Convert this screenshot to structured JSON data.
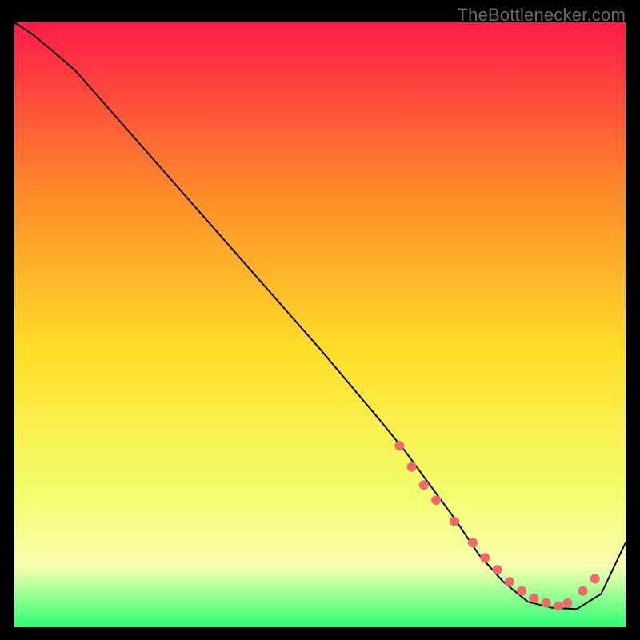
{
  "watermark": "TheBottlenecker.com",
  "chart_data": {
    "type": "line",
    "title": "",
    "xlabel": "",
    "ylabel": "",
    "xlim": [
      0,
      100
    ],
    "ylim": [
      0,
      100
    ],
    "background_gradient": {
      "top": "#ff1a4a",
      "mid_upper": "#ff8a2a",
      "mid": "#ffe02a",
      "mid_lower": "#f2ff70",
      "low_band": "#f9ffb0",
      "bottom": "#2aff73"
    },
    "series": [
      {
        "name": "curve",
        "color": "#000000",
        "x": [
          0,
          3,
          6,
          10,
          20,
          30,
          40,
          50,
          60,
          64,
          68,
          72,
          76,
          80,
          84,
          88,
          92,
          96,
          100
        ],
        "y": [
          100,
          98,
          95.5,
          92,
          80.5,
          69,
          57.5,
          46,
          34,
          29,
          23.5,
          18,
          12,
          7.5,
          4.2,
          3.2,
          3,
          5.5,
          14
        ]
      }
    ],
    "markers": {
      "name": "dots",
      "color": "#f06a6a",
      "x": [
        63,
        65,
        67,
        69,
        72,
        75,
        77,
        79,
        81,
        83,
        85,
        87,
        89,
        90.5,
        93,
        95
      ],
      "y": [
        30,
        26.5,
        23.5,
        21,
        17.5,
        14,
        11.5,
        9.5,
        7.5,
        6,
        4.8,
        4,
        3.5,
        4,
        6,
        8
      ]
    }
  }
}
